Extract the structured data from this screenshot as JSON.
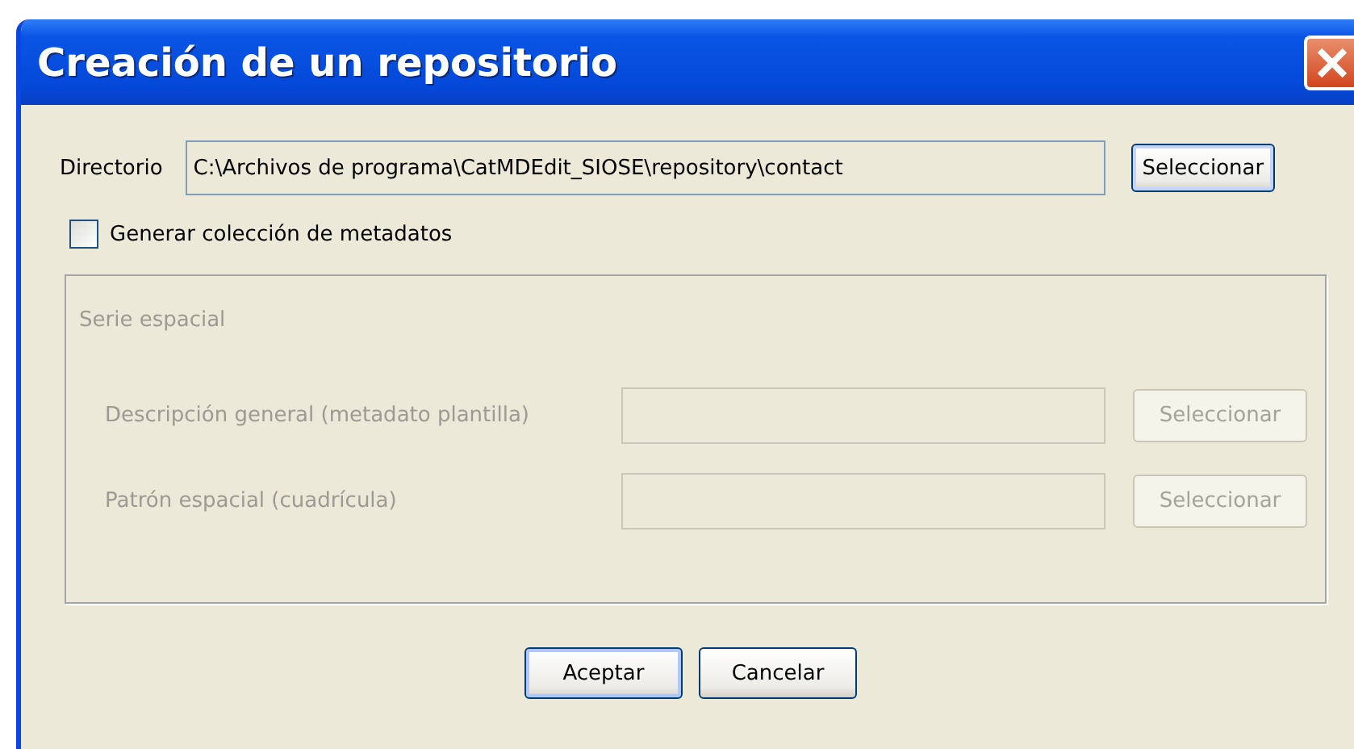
{
  "window": {
    "title": "Creación de un repositorio"
  },
  "directory": {
    "label": "Directorio",
    "value": "C:\\Archivos de programa\\CatMDEdit_SIOSE\\repository\\contact",
    "button": "Seleccionar"
  },
  "generate_collection": {
    "label": "Generar colección de metadatos",
    "checked": false
  },
  "series": {
    "title": "Serie espacial",
    "disabled": true,
    "rows": [
      {
        "label": "Descripción general (metadato plantilla)",
        "button": "Seleccionar"
      },
      {
        "label": "Patrón espacial (cuadrícula)",
        "button": "Seleccionar"
      }
    ]
  },
  "buttons": [
    {
      "label": "Aceptar",
      "default": true
    },
    {
      "label": "Cancelar",
      "default": false
    }
  ]
}
